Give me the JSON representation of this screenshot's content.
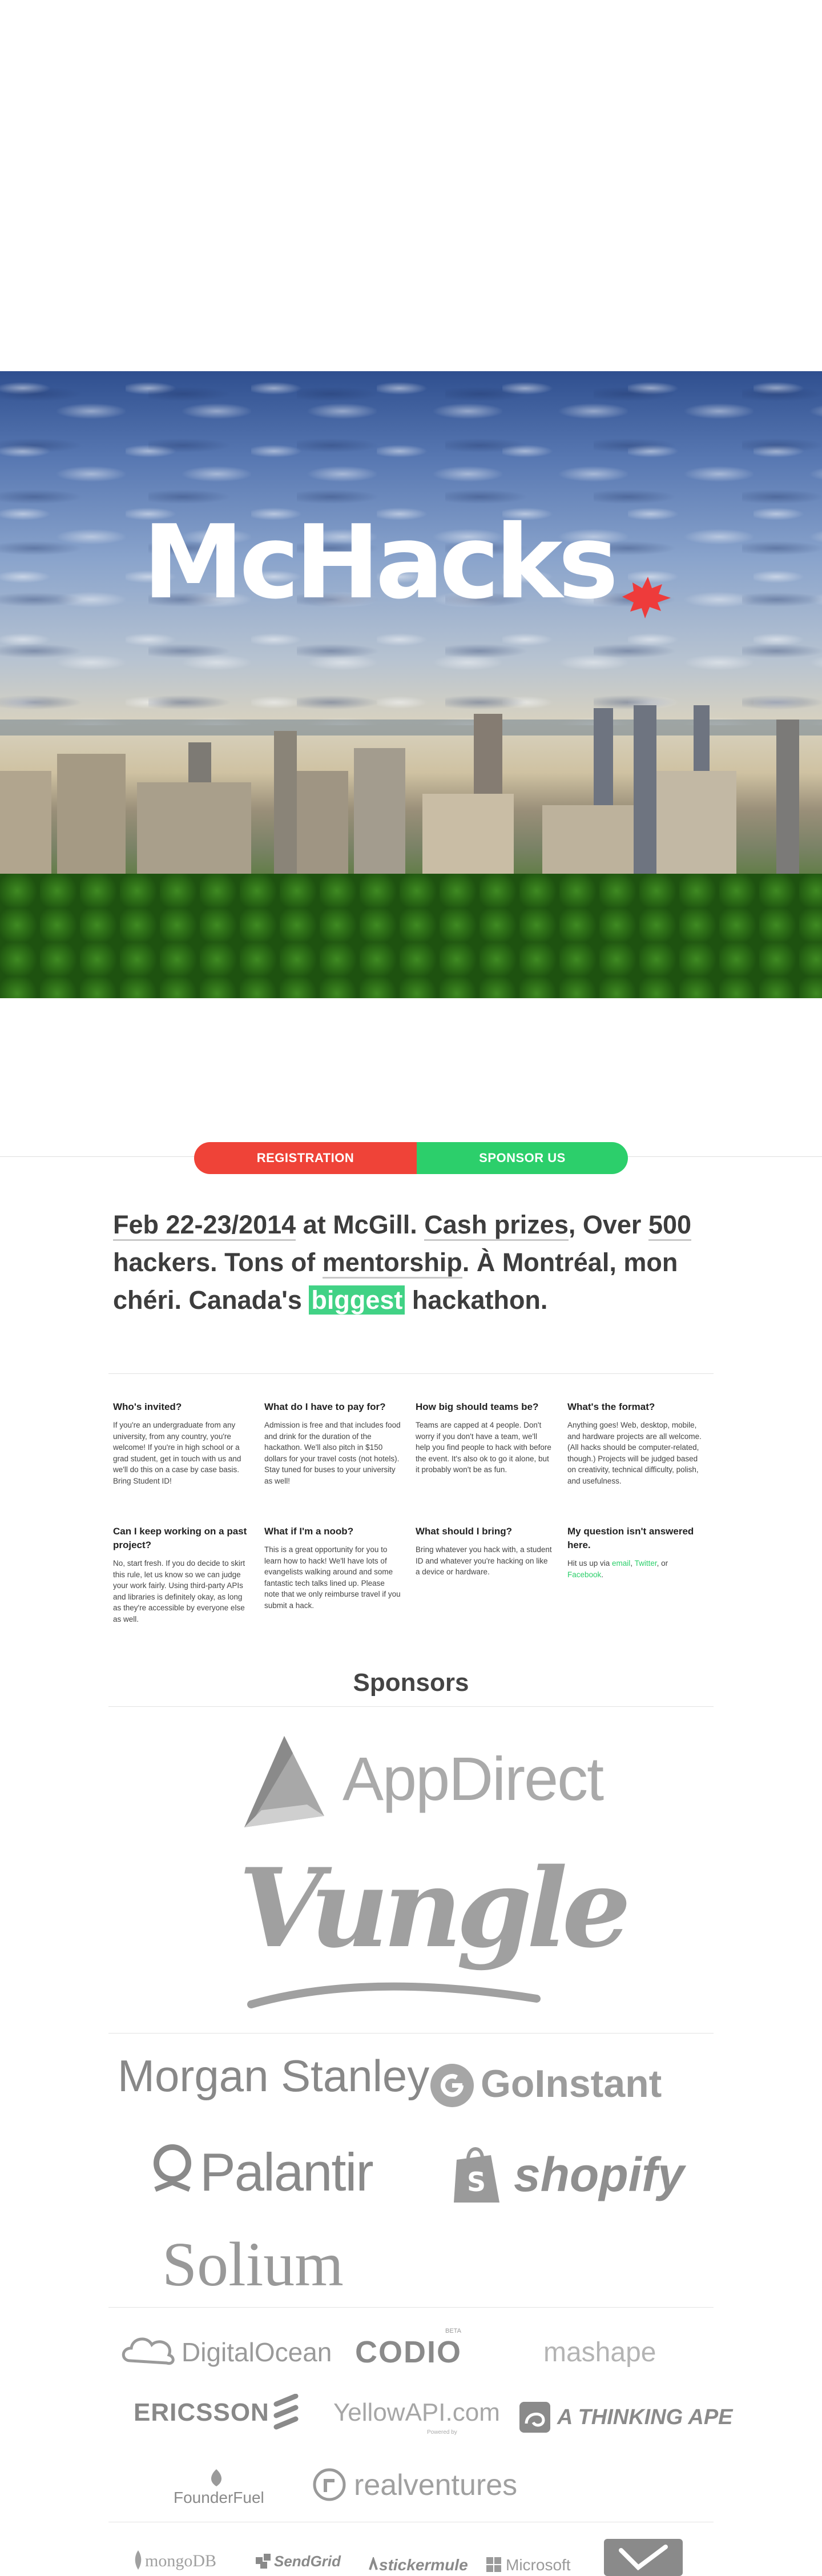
{
  "hero": {
    "title": "McHacks"
  },
  "nav": {
    "registration": "REGISTRATION",
    "sponsor": "SPONSOR US"
  },
  "tagline": {
    "p1": "Feb 22-23/2014",
    "p2": " at McGill. ",
    "p3": "Cash prizes",
    "p4": ", Over ",
    "p5": "500",
    "p6": " hackers. Tons of ",
    "p7": "mentorship",
    "p8": ". À Montréal, mon chéri. Canada's ",
    "p9": "biggest",
    "p10": " hackathon."
  },
  "faq": [
    {
      "q": "Who's invited?",
      "a": "If you're an undergraduate from any university, from any country, you're welcome! If you're in high school or a grad student, get in touch with us and we'll do this on a case by case basis. Bring Student ID!"
    },
    {
      "q": "What do I have to pay for?",
      "a": "Admission is free and that includes food and drink for the duration of the hackathon. We'll also pitch in $150 dollars for your travel costs (not hotels). Stay tuned for buses to your university as well!"
    },
    {
      "q": "How big should teams be?",
      "a": "Teams are capped at 4 people. Don't worry if you don't have a team, we'll help you find people to hack with before the event. It's also ok to go it alone, but it probably won't be as fun."
    },
    {
      "q": "What's the format?",
      "a": "Anything goes! Web, desktop, mobile, and hardware projects are all welcome. (All hacks should be computer-related, though.) Projects will be judged based on creativity, technical difficulty, polish, and usefulness."
    },
    {
      "q": "Can I keep working on a past project?",
      "a": "No, start fresh. If you do decide to skirt this rule, let us know so we can judge your work fairly. Using third-party APIs and libraries is definitely okay, as long as they're accessible by everyone else as well."
    },
    {
      "q": "What if I'm a noob?",
      "a": "This is a great opportunity for you to learn how to hack! We'll have lots of evangelists walking around and some fantastic tech talks lined up. Please note that we only reimburse travel if you submit a hack."
    },
    {
      "q": "What should I bring?",
      "a": "Bring whatever you hack with, a student ID and whatever you're hacking on like a device or hardware."
    },
    {
      "q": "My question isn't answered here.",
      "a_pre": "Hit us up via ",
      "link_email": "email",
      "a_mid": ", ",
      "link_twitter": "Twitter",
      "a_mid2": ", or ",
      "link_facebook": "Facebook",
      "a_post": "."
    }
  ],
  "sponsors": {
    "title": "Sponsors",
    "appdirect": "AppDirect",
    "vungle": "Vungle",
    "morgan": "Morgan Stanley",
    "goinstant": "GoInstant",
    "palantir": "Palantir",
    "shopify": "shopify",
    "solium": "Solium",
    "digitalocean": "DigitalOcean",
    "codio": "CODIO",
    "codio_beta": "BETA",
    "mashape": "mashape",
    "ericsson": "ERICSSON",
    "yellowapi": "YellowAPI.com",
    "yellowapi_sub": "Powered by",
    "thinkingape": "A THINKING APE",
    "founderfuel": "FounderFuel",
    "realventures": "realventures",
    "mongodb": "mongoDB",
    "sendgrid": "SendGrid",
    "stickermule": "stickermule",
    "microsoft": "Microsoft"
  },
  "colors": {
    "red": "#ef4338",
    "green": "#2ccf6b",
    "highlight": "#41d285"
  }
}
